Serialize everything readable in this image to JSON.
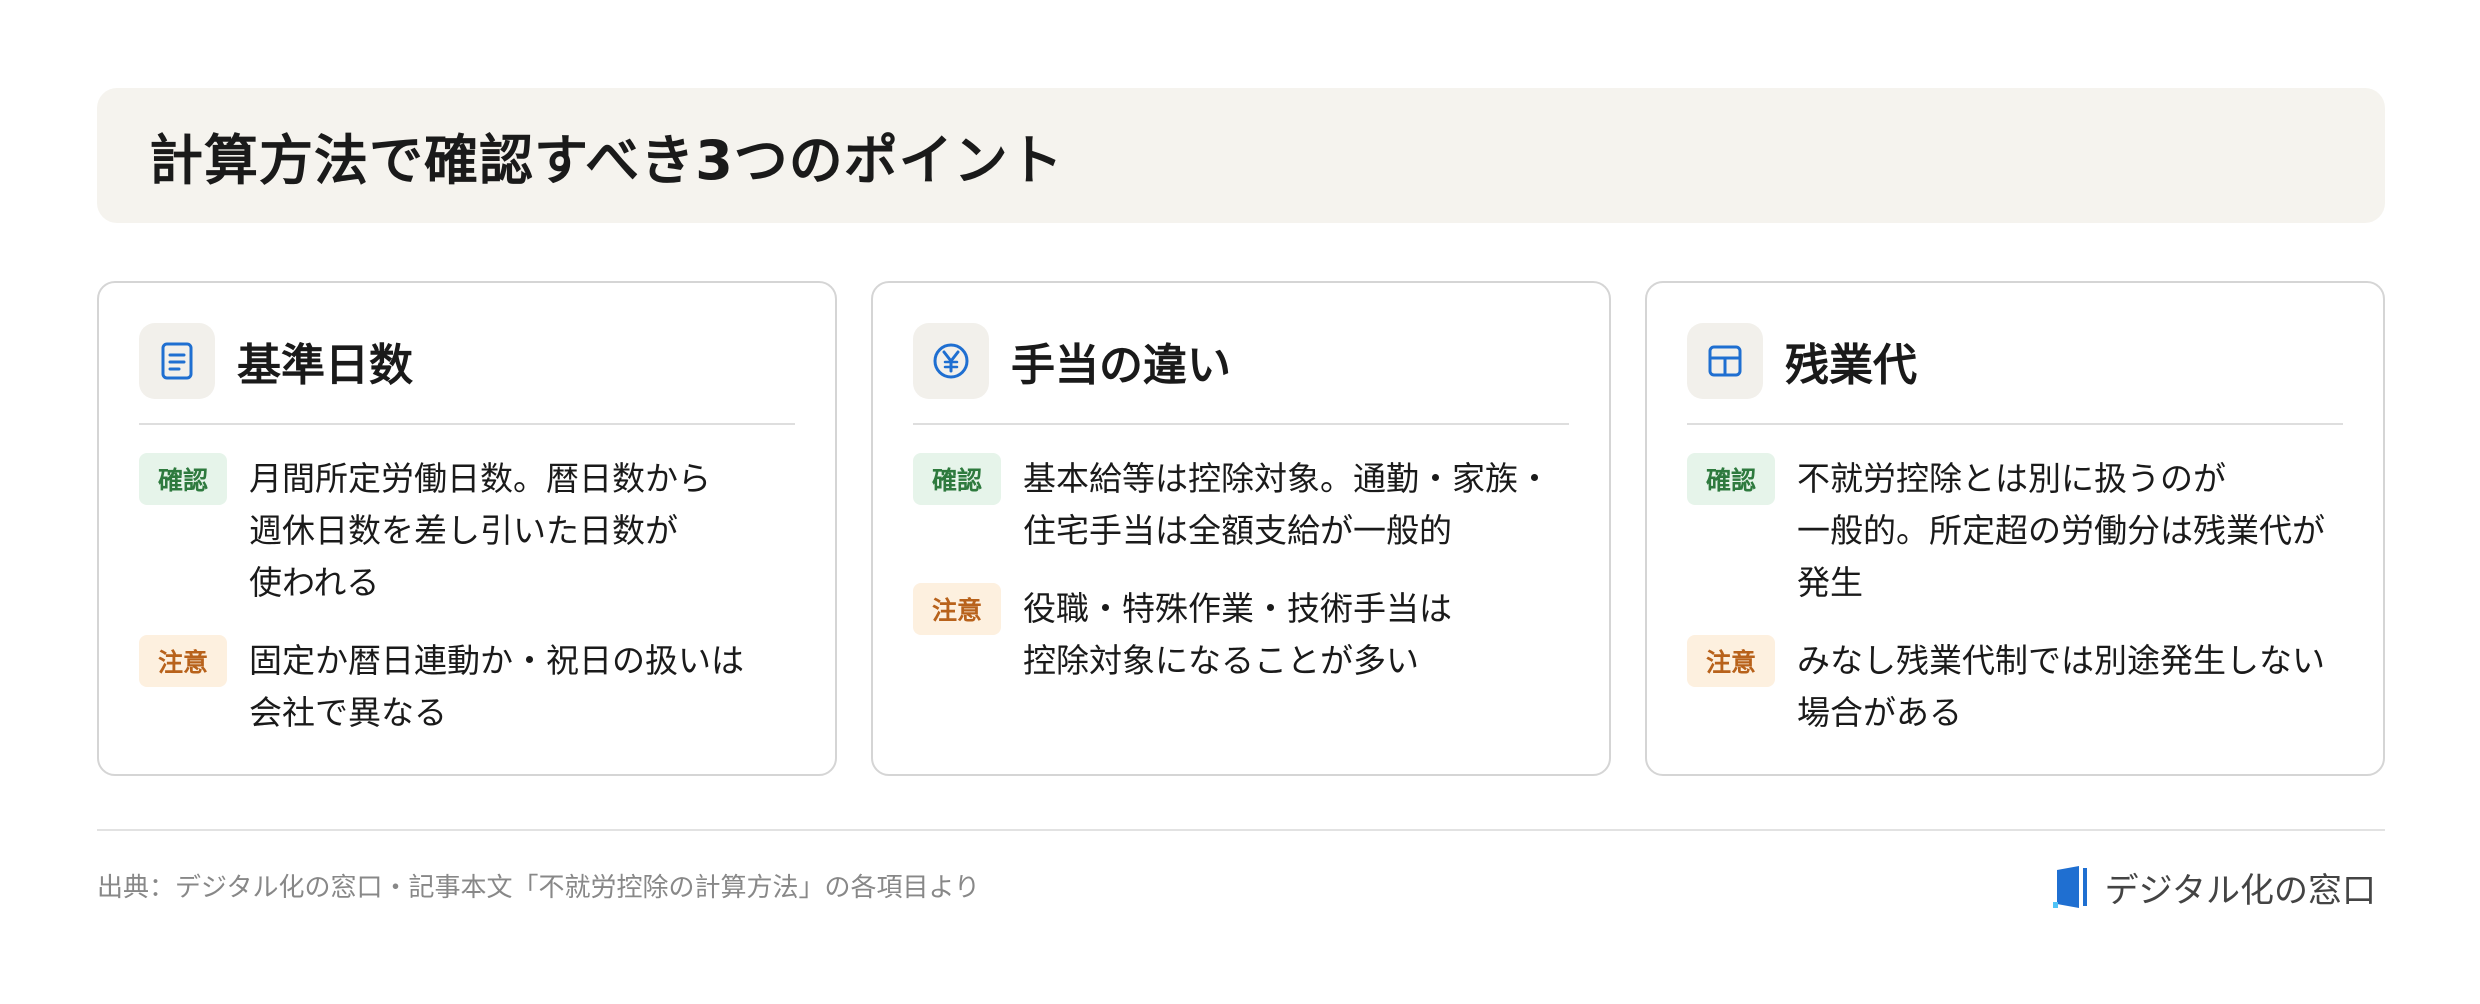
{
  "title": "計算方法で確認すべき3つのポイント",
  "tags": {
    "confirm": "確認",
    "caution": "注意"
  },
  "cards": [
    {
      "icon": "document-icon",
      "title": "基準日数",
      "confirm": "月間所定労働日数。暦日数から\n週休日数を差し引いた日数が\n使われる",
      "caution": "固定か暦日連動か・祝日の扱いは\n会社で異なる"
    },
    {
      "icon": "yen-icon",
      "title": "手当の違い",
      "confirm": "基本給等は控除対象。通勤・家族・\n住宅手当は全額支給が一般的",
      "caution": "役職・特殊作業・技術手当は\n控除対象になることが多い"
    },
    {
      "icon": "table-icon",
      "title": "残業代",
      "confirm": "不就労控除とは別に扱うのが\n一般的。所定超の労働分は残業代が\n発生",
      "caution": "みなし残業代制では別途発生しない\n場合がある"
    }
  ],
  "footer": {
    "source": "出典：デジタル化の窓口・記事本文「不就労控除の計算方法」の各項目より",
    "logo_text": "デジタル化の窓口"
  },
  "colors": {
    "accent_blue": "#1f6fd1",
    "confirm_bg": "#e6f4ea",
    "confirm_text": "#2e7a3e",
    "caution_bg": "#fdf0df",
    "caution_text": "#b8621b"
  }
}
